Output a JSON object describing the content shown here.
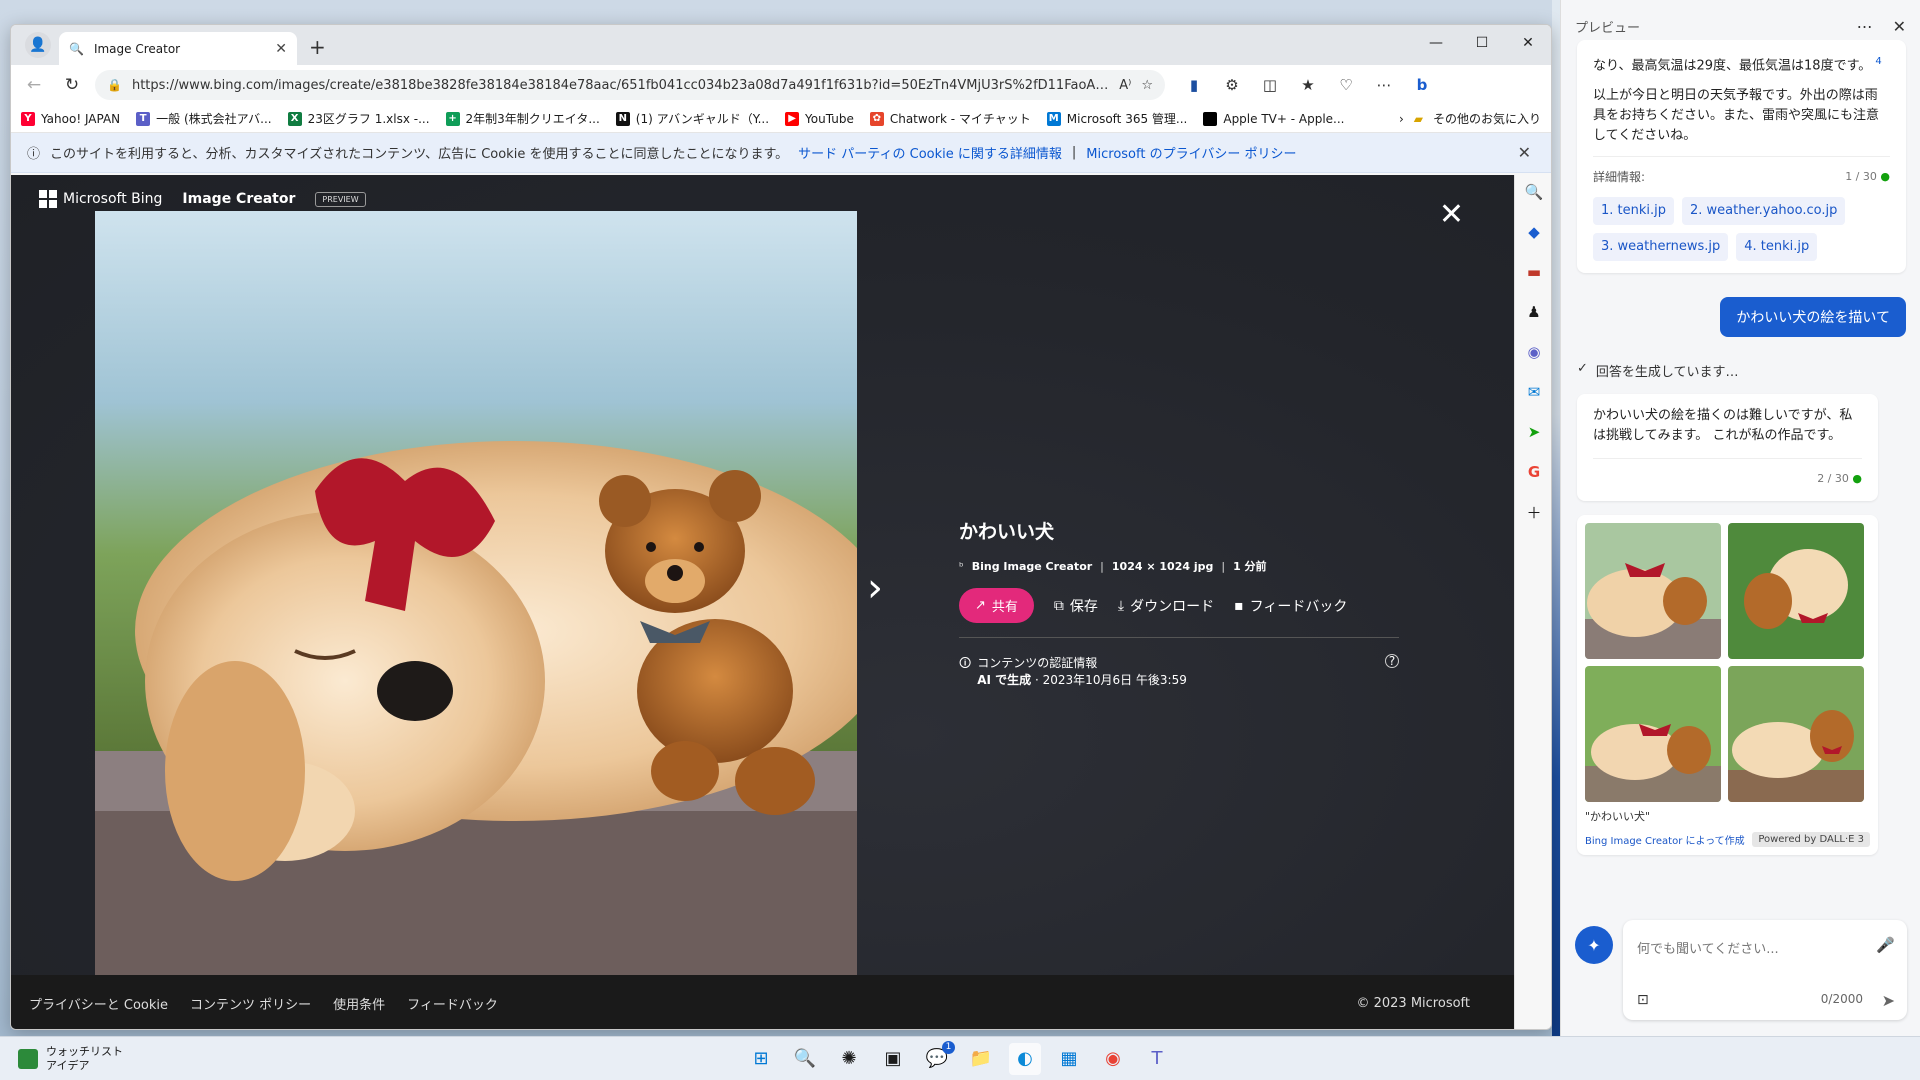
{
  "browser": {
    "tab_title": "Image Creator",
    "new_tab": "+",
    "url": "https://www.bing.com/images/create/e3818be3828fe38184e38184e78aac/651fb041cc034b23a08d7a491f1f631b?id=50EzTn4VMjU3rS%2fD11FaoA%3d%3d&vi...",
    "bookmarks": [
      {
        "label": "Yahoo! JAPAN",
        "color": "#ff0033",
        "glyph": "Y"
      },
      {
        "label": "一般 (株式会社アバ...",
        "color": "#5b5fc7",
        "glyph": "T"
      },
      {
        "label": "23区グラフ 1.xlsx -...",
        "color": "#107c41",
        "glyph": "X"
      },
      {
        "label": "2年制3年制クリエイタ...",
        "color": "#0f9d58",
        "glyph": "+"
      },
      {
        "label": "(1) アバンギャルド（Y...",
        "color": "#111111",
        "glyph": "N"
      },
      {
        "label": "YouTube",
        "color": "#ff0000",
        "glyph": "▶"
      },
      {
        "label": "Chatwork - マイチャット",
        "color": "#e6452b",
        "glyph": "✿"
      },
      {
        "label": "Microsoft 365 管理...",
        "color": "#0078d4",
        "glyph": "M"
      },
      {
        "label": "Apple TV+ - Apple...",
        "color": "#000000",
        "glyph": ""
      }
    ],
    "other_favorites": "その他のお気に入り"
  },
  "cookie_banner": {
    "text": "このサイトを利用すると、分析、カスタマイズされたコンテンツ、広告に Cookie を使用することに同意したことになります。",
    "link1": "サード パーティの Cookie に関する詳細情報",
    "separator": "|",
    "link2": "Microsoft のプライバシー ポリシー"
  },
  "bing": {
    "brand": "Microsoft Bing",
    "product": "Image Creator",
    "preview": "PREVIEW"
  },
  "image_detail": {
    "title": "かわいい犬",
    "source": "Bing Image Creator",
    "size": "1024 × 1024 jpg",
    "time": "1 分前",
    "share": "共有",
    "save": "保存",
    "download": "ダウンロード",
    "feedback": "フィードバック",
    "credentials_title": "コンテンツの認証情報",
    "ai_generated": "AI で生成",
    "date": "· 2023年10月6日 午後3:59"
  },
  "footer": {
    "links": [
      "プライバシーと Cookie",
      "コンテンツ ポリシー",
      "使用条件",
      "フィードバック"
    ],
    "copyright": "© 2023 Microsoft"
  },
  "copilot": {
    "header": "プレビュー",
    "weather_text": "なり、最高気温は29度、最低気温は18度です。",
    "weather_cite": "4",
    "weather_text2": "以上が今日と明日の天気予報です。外出の際は雨具をお持ちください。また、雷雨や突風にも注意してくださいね。",
    "details_label": "詳細情報:",
    "details_count": "1 / 30",
    "sources": [
      "1. tenki.jp",
      "2. weather.yahoo.co.jp",
      "3. weathernews.jp",
      "4. tenki.jp"
    ],
    "user_message": "かわいい犬の絵を描いて",
    "status": "回答を生成しています…",
    "answer": "かわいい犬の絵を描くのは難しいですが、私は挑戦してみます。 これが私の作品です。",
    "answer_count": "2 / 30",
    "card_caption": "\"かわいい犬\"",
    "card_link": "Bing Image Creator によって作成",
    "card_powered": "Powered by DALL·E 3",
    "input_placeholder": "何でも聞いてください...",
    "char_count": "0/2000"
  },
  "taskbar": {
    "widget_title": "ウォッチリスト",
    "widget_sub": "アイデア",
    "chat_badge": "1"
  }
}
